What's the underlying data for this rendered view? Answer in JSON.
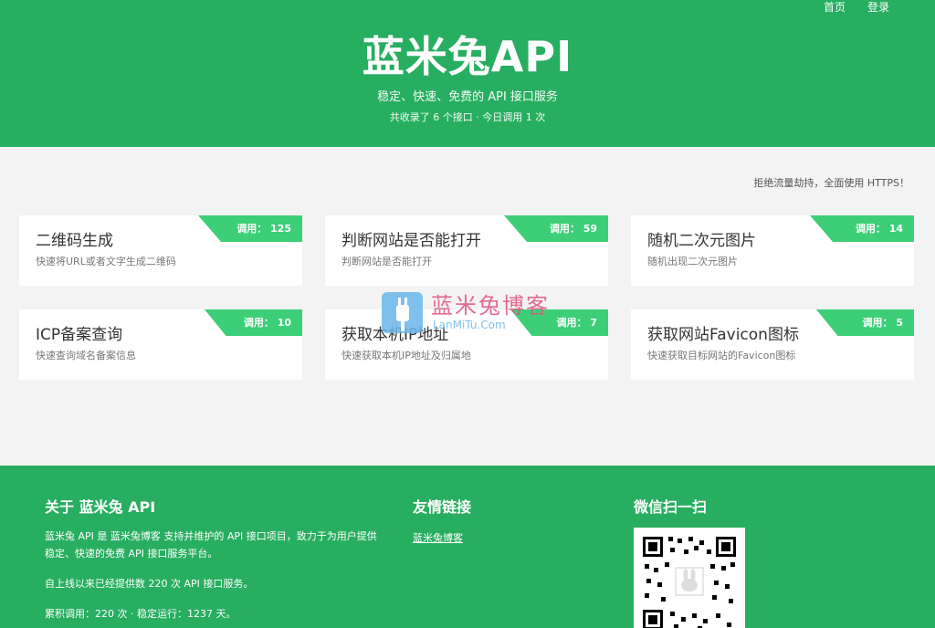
{
  "nav": {
    "home": "首页",
    "login": "登录"
  },
  "hero": {
    "title": "蓝米兔API",
    "subtitle": "稳定、快速、免费的 API 接口服务",
    "stat": "共收录了 6 个接口 · 今日调用 1 次"
  },
  "notice": "拒绝流量劫持，全面使用 HTTPS！",
  "cards": [
    {
      "title": "二维码生成",
      "desc": "快速将URL或者文字生成二维码",
      "badge": "调用： 125"
    },
    {
      "title": "判断网站是否能打开",
      "desc": "判断网站是否能打开",
      "badge": "调用： 59"
    },
    {
      "title": "随机二次元图片",
      "desc": "随机出现二次元图片",
      "badge": "调用： 14"
    },
    {
      "title": "ICP备案查询",
      "desc": "快速查询域名备案信息",
      "badge": "调用： 10"
    },
    {
      "title": "获取本机IP地址",
      "desc": "快速获取本机IP地址及归属地",
      "badge": "调用： 7"
    },
    {
      "title": "获取网站Favicon图标",
      "desc": "快速获取目标网站的Favicon图标",
      "badge": "调用： 5"
    }
  ],
  "watermark": {
    "title": "蓝米兔博客",
    "url": "LanMiTu.Com"
  },
  "footer": {
    "about_title": "关于 蓝米兔 API",
    "about_p1": "蓝米兔 API 是 蓝米兔博客 支持并维护的 API 接口项目，致力于为用户提供稳定、快速的免费 API 接口服务平台。",
    "about_p2": "自上线以来已经提供数 220 次 API 接口服务。",
    "about_p3": "累积调用：220 次 · 稳定运行：1237 天。",
    "links_title": "友情链接",
    "link1": "蓝米兔博客",
    "wechat_title": "微信扫一扫"
  }
}
